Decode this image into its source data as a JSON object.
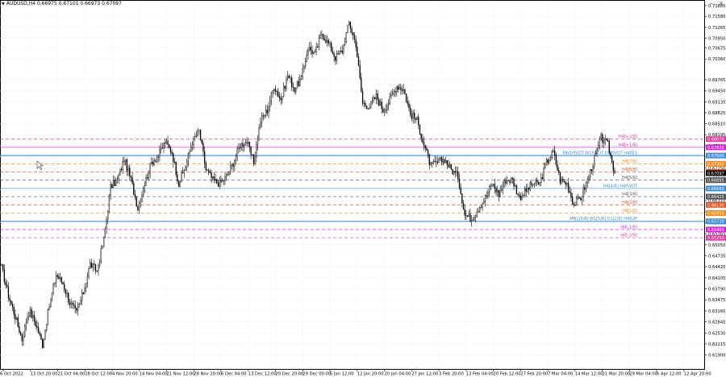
{
  "window": {
    "symbol_header": "AUDUSD,H4  0.66975 0.67101 0.66973 0.67097"
  },
  "chart_data": {
    "type": "candlestick",
    "symbol": "AUDUSD",
    "timeframe": "H4",
    "ohlc_current": {
      "open": 0.66975,
      "high": 0.67101,
      "low": 0.66973,
      "close": 0.67097
    },
    "ylim": [
      0.615,
      0.72
    ],
    "yticks": [
      "0.71885",
      "0.71580",
      "0.71265",
      "0.70950",
      "0.70675",
      "0.70360",
      "0.69765",
      "0.69450",
      "0.69135",
      "0.68825",
      "0.68510",
      "0.68195",
      "0.67880",
      "0.67565",
      "0.67250",
      "0.66940",
      "0.66625",
      "0.66310",
      "0.65995",
      "0.65680",
      "0.65365",
      "0.65050",
      "0.64735",
      "0.64420",
      "0.64105",
      "0.63790",
      "0.63475",
      "0.63160",
      "0.62845",
      "0.62530",
      "0.62215",
      "0.61900"
    ],
    "xticks": [
      "6 Oct 2022",
      "13 Oct 20:00",
      "21 Oct 04:00",
      "28 Oct 12:00",
      "4 Nov 20:00",
      "14 Nov 04:00",
      "21 Nov 12:00",
      "28 Nov 20:00",
      "6 Dec 04:00",
      "13 Dec 12:00",
      "20 Dec 20:00",
      "29 Dec 00:00",
      "5 Jan 12:00",
      "12 Jan 20:00",
      "20 Jan 04:00",
      "27 Jan 12:00",
      "3 Feb 20:00",
      "13 Feb 04:00",
      "20 Feb 12:00",
      "27 Feb 20:00",
      "7 Mar 04:00",
      "14 Mar 12:00",
      "21 Mar 20:00",
      "29 Mar 04:00",
      "5 Apr 12:00",
      "12 Apr 20:00"
    ],
    "price_path": [
      [
        "6 Oct 2022",
        0.644
      ],
      [
        "9 Oct",
        0.636
      ],
      [
        "12 Oct",
        0.63
      ],
      [
        "13 Oct 20:00",
        0.6235
      ],
      [
        "16 Oct",
        0.632
      ],
      [
        "18 Oct",
        0.628
      ],
      [
        "21 Oct 04:00",
        0.622
      ],
      [
        "23 Oct",
        0.633
      ],
      [
        "26 Oct",
        0.642
      ],
      [
        "28 Oct 12:00",
        0.6395
      ],
      [
        "31 Oct",
        0.634
      ],
      [
        "2 Nov",
        0.631
      ],
      [
        "4 Nov 20:00",
        0.637
      ],
      [
        "7 Nov",
        0.645
      ],
      [
        "9 Nov",
        0.643
      ],
      [
        "10 Nov",
        0.652
      ],
      [
        "11 Nov",
        0.667
      ],
      [
        "14 Nov 04:00",
        0.669
      ],
      [
        "16 Nov",
        0.675
      ],
      [
        "18 Nov",
        0.669
      ],
      [
        "21 Nov 12:00",
        0.661
      ],
      [
        "23 Nov",
        0.668
      ],
      [
        "25 Nov",
        0.674
      ],
      [
        "28 Nov 20:00",
        0.676
      ],
      [
        "30 Nov",
        0.68
      ],
      [
        "2 Dec",
        0.677
      ],
      [
        "6 Dec 04:00",
        0.668
      ],
      [
        "8 Dec",
        0.673
      ],
      [
        "10 Dec",
        0.68
      ],
      [
        "13 Dec 12:00",
        0.683
      ],
      [
        "15 Dec",
        0.672
      ],
      [
        "17 Dec",
        0.669
      ],
      [
        "20 Dec 20:00",
        0.668
      ],
      [
        "22 Dec",
        0.67
      ],
      [
        "24 Dec",
        0.674
      ],
      [
        "29 Dec 00:00",
        0.679
      ],
      [
        "1 Jan",
        0.68
      ],
      [
        "3 Jan",
        0.674
      ],
      [
        "5 Jan 12:00",
        0.686
      ],
      [
        "7 Jan",
        0.689
      ],
      [
        "9 Jan",
        0.696
      ],
      [
        "12 Jan 20:00",
        0.692
      ],
      [
        "14 Jan",
        0.699
      ],
      [
        "17 Jan",
        0.695
      ],
      [
        "20 Jan 04:00",
        0.698
      ],
      [
        "22 Jan",
        0.707
      ],
      [
        "24 Jan",
        0.705
      ],
      [
        "25 Jan",
        0.711
      ],
      [
        "27 Jan 12:00",
        0.708
      ],
      [
        "29 Jan",
        0.704
      ],
      [
        "31 Jan",
        0.706
      ],
      [
        "1 Feb",
        0.714
      ],
      [
        "2 Feb",
        0.708
      ],
      [
        "3 Feb 20:00",
        0.691
      ],
      [
        "6 Feb",
        0.69
      ],
      [
        "8 Feb",
        0.693
      ],
      [
        "10 Feb",
        0.689
      ],
      [
        "13 Feb 04:00",
        0.692
      ],
      [
        "15 Feb",
        0.696
      ],
      [
        "16 Feb",
        0.695
      ],
      [
        "18 Feb",
        0.688
      ],
      [
        "20 Feb 12:00",
        0.686
      ],
      [
        "22 Feb",
        0.679
      ],
      [
        "24 Feb",
        0.673
      ],
      [
        "27 Feb 20:00",
        0.674
      ],
      [
        "1 Mar",
        0.675
      ],
      [
        "3 Mar",
        0.672
      ],
      [
        "5 Mar",
        0.67
      ],
      [
        "7 Mar 04:00",
        0.659
      ],
      [
        "9 Mar",
        0.658
      ],
      [
        "10 Mar",
        0.661
      ],
      [
        "12 Mar",
        0.664
      ],
      [
        "14 Mar 12:00",
        0.668
      ],
      [
        "16 Mar",
        0.665
      ],
      [
        "18 Mar",
        0.669
      ],
      [
        "21 Mar 20:00",
        0.669
      ],
      [
        "23 Mar",
        0.664
      ],
      [
        "25 Mar",
        0.666
      ],
      [
        "29 Mar 04:00",
        0.668
      ],
      [
        "31 Mar",
        0.668
      ],
      [
        "3 Apr",
        0.674
      ],
      [
        "4 Apr",
        0.677
      ],
      [
        "5 Apr 12:00",
        0.669
      ],
      [
        "7 Apr",
        0.668
      ],
      [
        "10 Apr",
        0.662
      ],
      [
        "11 Apr",
        0.664
      ],
      [
        "12 Apr 20:00",
        0.669
      ],
      [
        "13 Apr",
        0.675
      ],
      [
        "14 Apr",
        0.681
      ],
      [
        "15 Apr",
        0.679
      ],
      [
        "17 Apr",
        0.671
      ]
    ],
    "levels": [
      {
        "price": 0.6807,
        "price_label": "0.68070",
        "line_label": "H4[+2/8]",
        "color": "#e23aa0",
        "dash": true
      },
      {
        "price": 0.67835,
        "price_label": "0.67835",
        "line_label": "H4[+1/8]",
        "color": "#e020e0",
        "dash": false
      },
      {
        "price": 0.676,
        "price_label": "0.67600",
        "line_label": "MN1PIVOT W1PIVOT D1PIVOT H4RES",
        "color": "#3d8fdb",
        "dash": false,
        "thick": true
      },
      {
        "price": 0.67365,
        "price_label": "0.67365",
        "line_label": "H4[7/8]",
        "color": "#ff8c1a",
        "dash": true
      },
      {
        "price": 0.6713,
        "price_label": "0.67130",
        "line_label": "H4[6/8]",
        "color": "#e8532a",
        "dash": true
      },
      {
        "price": 0.66895,
        "price_label": "0.66895",
        "line_label": "H4[5/8]",
        "color": "#555555",
        "dash": true
      },
      {
        "price": 0.6666,
        "price_label": "0.66660",
        "line_label": "H4[4/8] H4PIVOT",
        "color": "#3d8fdb",
        "dash": false
      },
      {
        "price": 0.66425,
        "price_label": "0.66425",
        "line_label": "H4[3/8]",
        "color": "#555555",
        "dash": true
      },
      {
        "price": 0.6619,
        "price_label": "0.66190",
        "line_label": "H4[2/8]",
        "color": "#e8532a",
        "dash": true
      },
      {
        "price": 0.65955,
        "price_label": "0.65955",
        "line_label": "H4[1/8]",
        "color": "#ff8c1a",
        "dash": true
      },
      {
        "price": 0.6572,
        "price_label": "0.65720",
        "line_label": "MN1[5/8] W1[5/8] D1[2/8] H4SUP",
        "color": "#3d8fdb",
        "dash": false,
        "thick": true
      },
      {
        "price": 0.65485,
        "price_label": "0.65485",
        "line_label": "H4[-1/8]",
        "color": "#e020e0",
        "dash": true
      },
      {
        "price": 0.6525,
        "price_label": "0.65250",
        "line_label": "H4[-2/8]",
        "color": "#e23aa0",
        "dash": true
      }
    ],
    "current_price_label": "0.67097",
    "grid": true
  }
}
